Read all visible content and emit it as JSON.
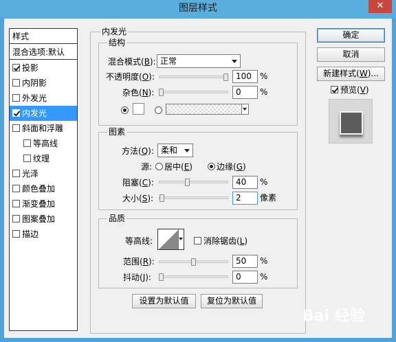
{
  "window": {
    "title": "图层样式",
    "close_glyph": "✕"
  },
  "style_list": {
    "header": "样式",
    "blend_default": "混合选项:默认",
    "items": [
      {
        "label": "投影",
        "checked": true,
        "selected": false,
        "indent": false
      },
      {
        "label": "内阴影",
        "checked": false,
        "selected": false,
        "indent": false
      },
      {
        "label": "外发光",
        "checked": false,
        "selected": false,
        "indent": false
      },
      {
        "label": "内发光",
        "checked": true,
        "selected": true,
        "indent": false
      },
      {
        "label": "斜面和浮雕",
        "checked": false,
        "selected": false,
        "indent": false
      },
      {
        "label": "等高线",
        "checked": false,
        "selected": false,
        "indent": true
      },
      {
        "label": "纹理",
        "checked": false,
        "selected": false,
        "indent": true
      },
      {
        "label": "光泽",
        "checked": false,
        "selected": false,
        "indent": false
      },
      {
        "label": "颜色叠加",
        "checked": false,
        "selected": false,
        "indent": false
      },
      {
        "label": "渐变叠加",
        "checked": false,
        "selected": false,
        "indent": false
      },
      {
        "label": "图案叠加",
        "checked": false,
        "selected": false,
        "indent": false
      },
      {
        "label": "描边",
        "checked": false,
        "selected": false,
        "indent": false
      }
    ]
  },
  "inner_glow": {
    "title": "内发光",
    "structure": {
      "title": "结构",
      "blend_mode_label": "混合模式(",
      "blend_mode_key": "B",
      "blend_mode_value": "正常",
      "opacity_label": "不透明度(",
      "opacity_key": "O",
      "opacity_value": "100",
      "opacity_level": 1.0,
      "noise_label": "杂色(",
      "noise_key": "N",
      "noise_value": "0",
      "noise_level": 0.0,
      "percent": "%"
    },
    "elements": {
      "title": "图素",
      "technique_label": "方法(",
      "technique_key": "Q",
      "technique_value": "柔和",
      "source_label": "源:",
      "source_center": "居中(",
      "source_center_key": "E",
      "source_edge": "边缘(",
      "source_edge_key": "G",
      "source_selected": "edge",
      "choke_label": "阻塞(",
      "choke_key": "C",
      "choke_value": "40",
      "choke_level": 0.4,
      "size_label": "大小(",
      "size_key": "S",
      "size_value": "2",
      "size_level": 0.01,
      "size_unit": "像素",
      "percent": "%"
    },
    "quality": {
      "title": "品质",
      "contour_label": "等高线:",
      "anti_alias_label": "消除锯齿(",
      "anti_alias_key": "L",
      "range_label": "范围(",
      "range_key": "R",
      "range_value": "50",
      "range_level": 0.5,
      "jitter_label": "抖动(",
      "jitter_key": "J",
      "jitter_value": "0",
      "jitter_level": 0.0,
      "percent": "%"
    },
    "set_default": "设置为默认值",
    "reset_default": "复位为默认值"
  },
  "actions": {
    "ok": "确定",
    "cancel": "取消",
    "new_style_label": "新建样式(",
    "new_style_key": "W",
    "new_style_suffix": ")...",
    "preview_label": "预览(",
    "preview_key": "V",
    "preview_checked": true
  },
  "watermark": "Bai 经验"
}
